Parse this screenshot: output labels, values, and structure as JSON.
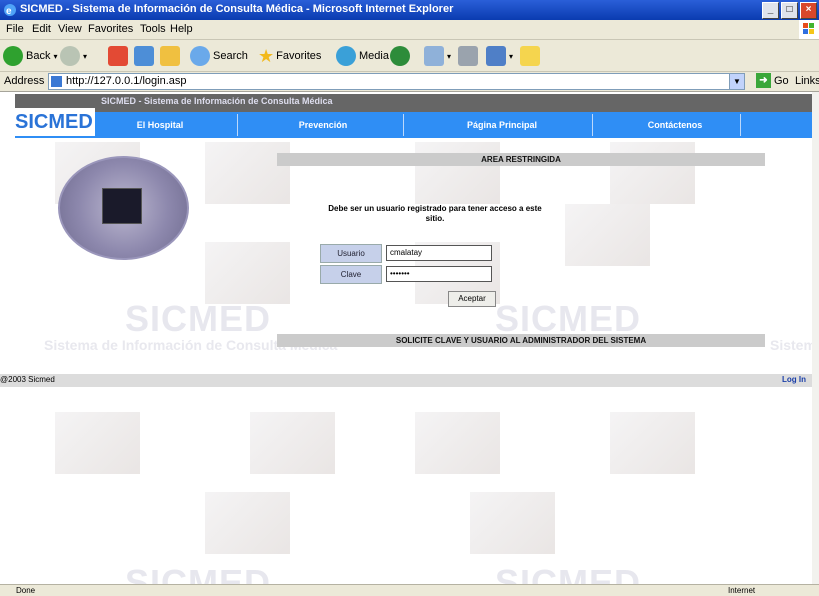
{
  "window": {
    "title": "SICMED - Sistema de Información de Consulta Médica - Microsoft Internet Explorer",
    "min": "_",
    "max": "□",
    "close": "×"
  },
  "menu": [
    "File",
    "Edit",
    "View",
    "Favorites",
    "Tools",
    "Help"
  ],
  "toolbar": {
    "back": "Back",
    "search": "Search",
    "favorites": "Favorites",
    "media": "Media"
  },
  "address": {
    "label": "Address",
    "url": "http://127.0.0.1/login.asp",
    "go": "Go",
    "links": "Links"
  },
  "site": {
    "title": "SICMED - Sistema de Información de Consulta Médica",
    "logo": "SICMED",
    "nav": [
      "El Hospital",
      "Prevención",
      "Página Principal",
      "Contáctenos"
    ]
  },
  "background": {
    "brand": "SICMED",
    "tagline": "Sistema de Información de Consulta Médica"
  },
  "login": {
    "header": "AREA RESTRINGIDA",
    "message": "Debe ser un usuario registrado para tener acceso a este sitio.",
    "user_label": "Usuario",
    "user_value": "cmalatay",
    "pass_label": "Clave",
    "pass_value": "•••••••",
    "submit": "Aceptar",
    "notice": "SOLICITE CLAVE Y USUARIO AL ADMINISTRADOR DEL SISTEMA"
  },
  "footer": {
    "copyright": "@2003 Sicmed",
    "login_link": "Log In"
  },
  "status": {
    "left": "Done",
    "zone": "Internet"
  },
  "colors": {
    "nav": "#2f8ef5",
    "header_bar": "#666666",
    "label_bg": "#c6d0ea"
  }
}
